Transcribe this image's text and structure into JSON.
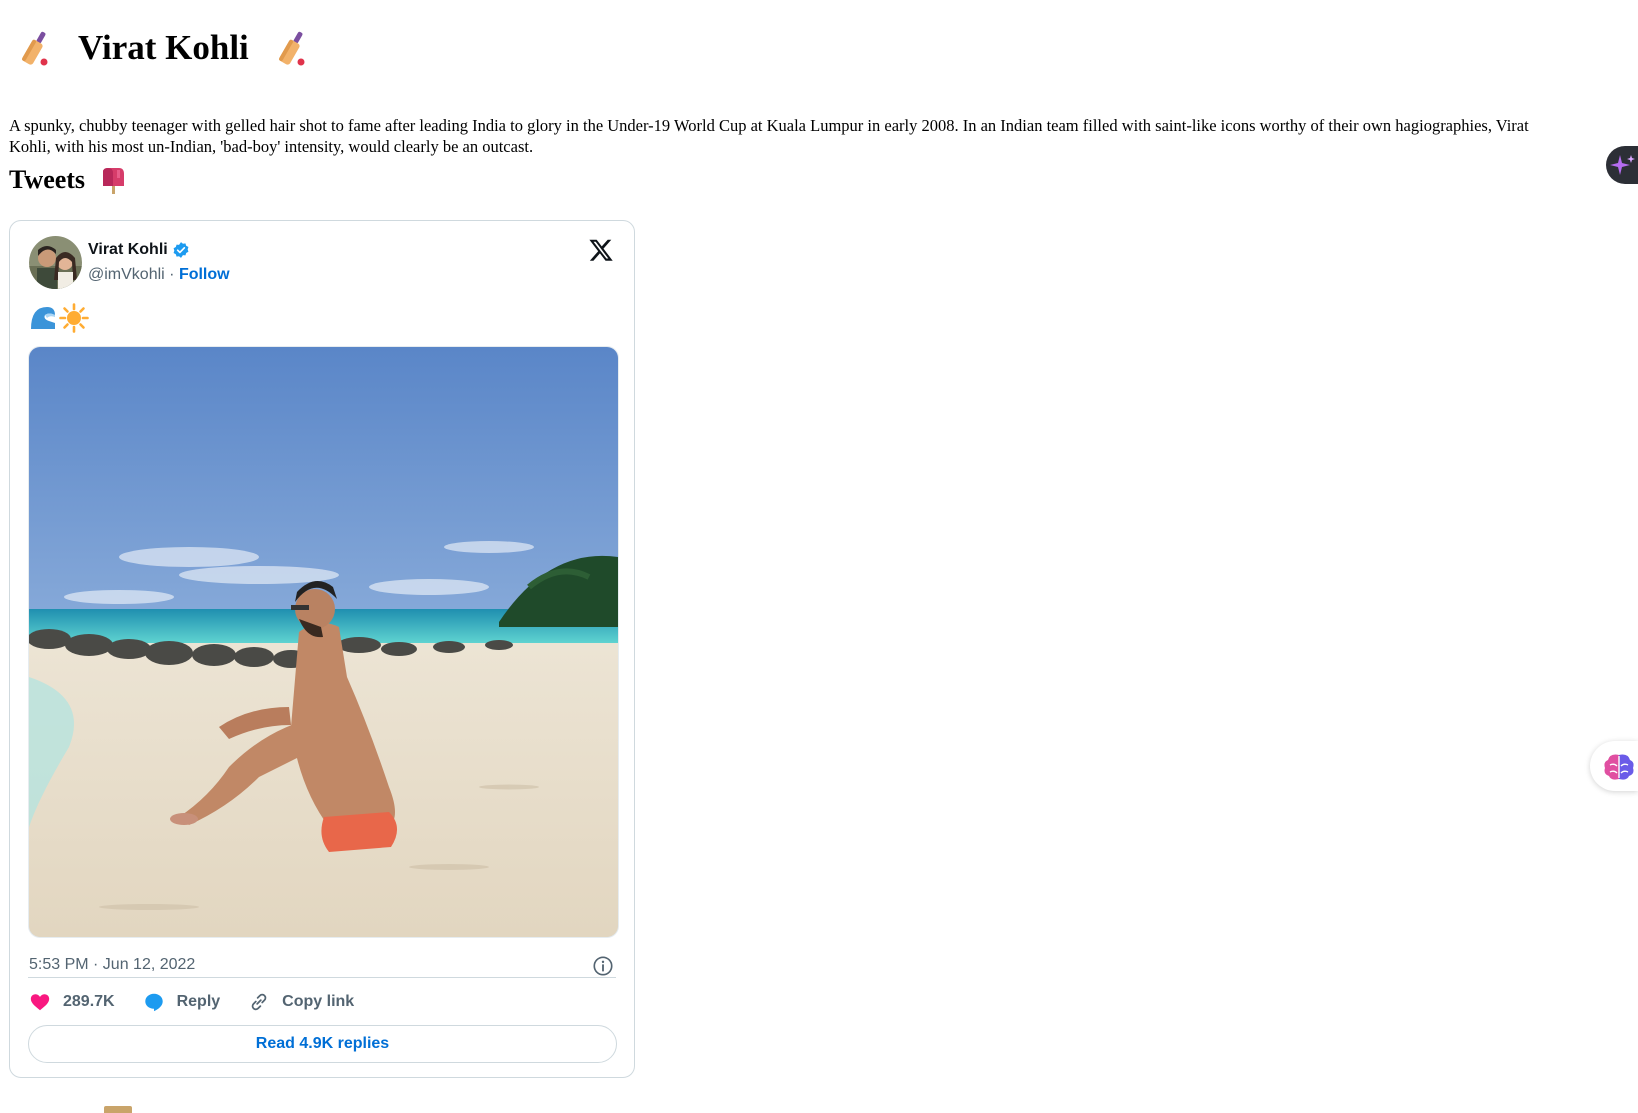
{
  "page": {
    "title": "Virat Kohli",
    "title_icon": "cricket-bat-icon",
    "intro": "A spunky, chubby teenager with gelled hair shot to fame after leading India to glory in the Under-19 World Cup at Kuala Lumpur in early 2008. In an Indian team filled with saint-like icons worthy of their own hagiographies, Virat Kohli, with his most un-Indian, 'bad-boy' intensity, would clearly be an outcast.",
    "tweets_heading": "Tweets",
    "tweets_icon": "mailbox-icon"
  },
  "tweet": {
    "author_name": "Virat Kohli",
    "verified": true,
    "handle": "@imVkohli",
    "separator": "·",
    "follow_label": "Follow",
    "text_icons": [
      "wave-icon",
      "sun-icon"
    ],
    "image": "beach-photo",
    "timestamp": "5:53 PM · Jun 12, 2022",
    "likes": "289.7K",
    "reply_label": "Reply",
    "copy_link_label": "Copy link",
    "read_replies_label": "Read 4.9K replies"
  },
  "colors": {
    "link_blue": "#006fd6",
    "heart_pink": "#f91880",
    "reply_blue": "#1d9bf0",
    "muted_text": "#536471",
    "border": "#cfd9de"
  }
}
